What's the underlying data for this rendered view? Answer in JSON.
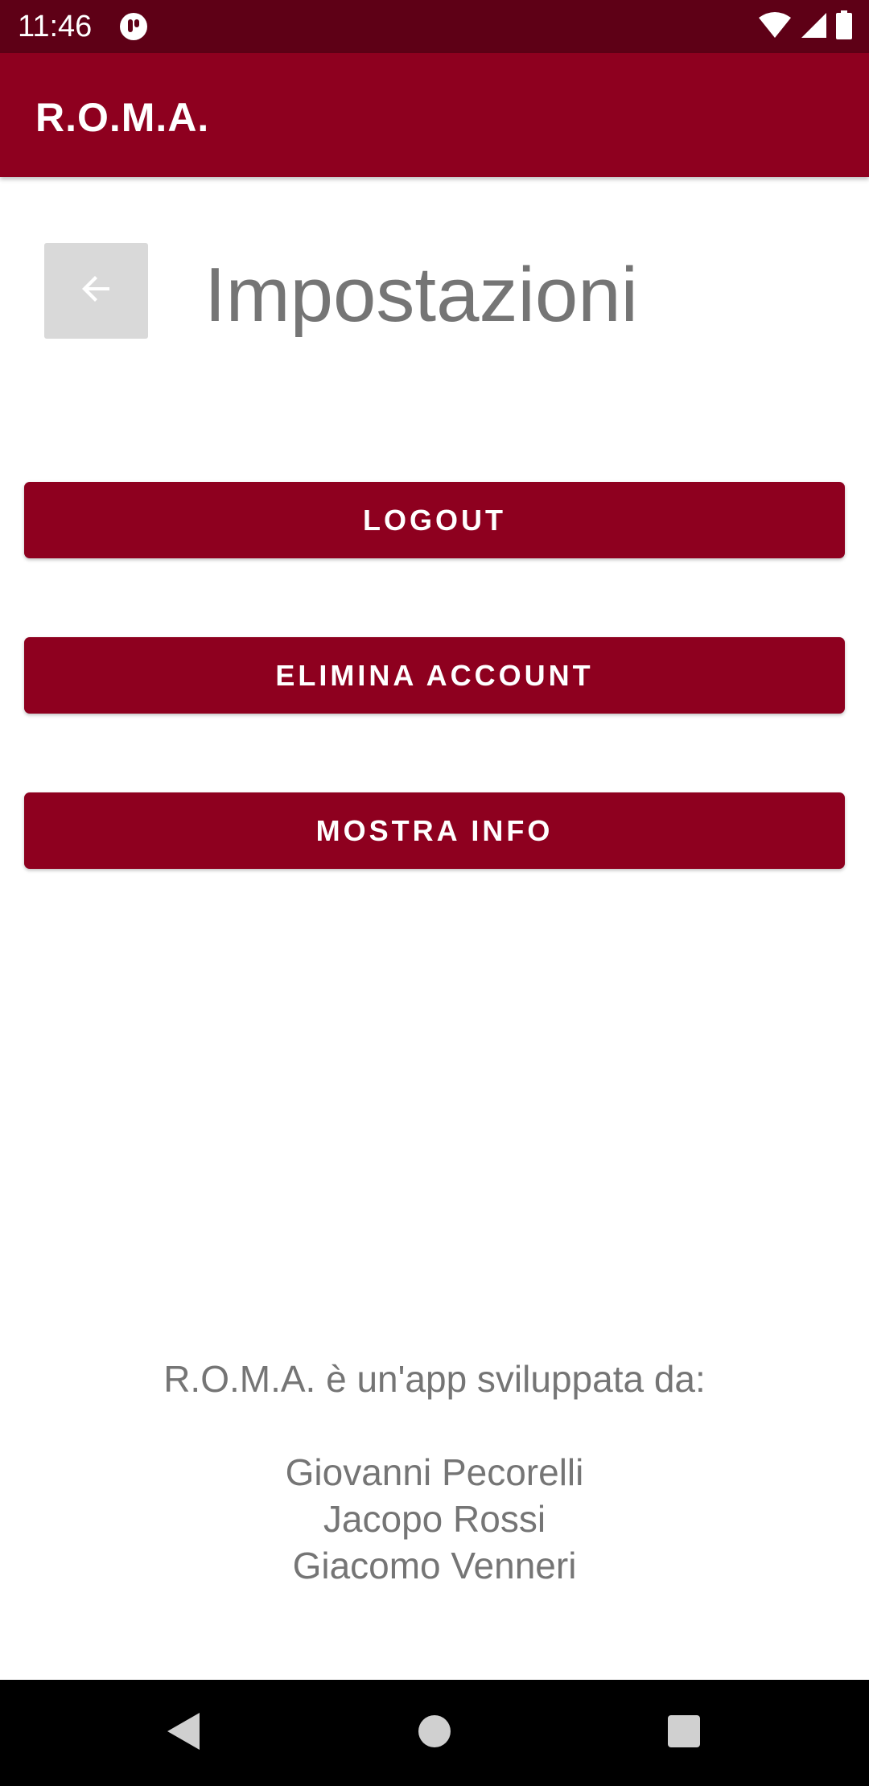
{
  "status_bar": {
    "time": "11:46",
    "notification_icon": "notification-app-icon",
    "wifi_icon": "wifi-icon",
    "signal_icon": "cell-signal-icon",
    "battery_icon": "battery-icon"
  },
  "app_bar": {
    "title": "R.O.M.A."
  },
  "header": {
    "back_icon": "arrow-back-icon",
    "title": "Impostazioni"
  },
  "buttons": {
    "logout": "LOGOUT",
    "delete_account": "ELIMINA ACCOUNT",
    "show_info": "MOSTRA INFO"
  },
  "info": {
    "intro": "R.O.M.A. è un'app sviluppata da:",
    "developers": [
      "Giovanni Pecorelli",
      "Jacopo Rossi",
      "Giacomo Venneri"
    ]
  },
  "nav_bar": {
    "back_icon": "nav-back-icon",
    "home_icon": "nav-home-icon",
    "recents_icon": "nav-recents-icon"
  },
  "colors": {
    "primary": "#8e001f",
    "status_bar": "#5e0016",
    "text_secondary": "#757575",
    "back_button_bg": "#d9d9d9"
  }
}
